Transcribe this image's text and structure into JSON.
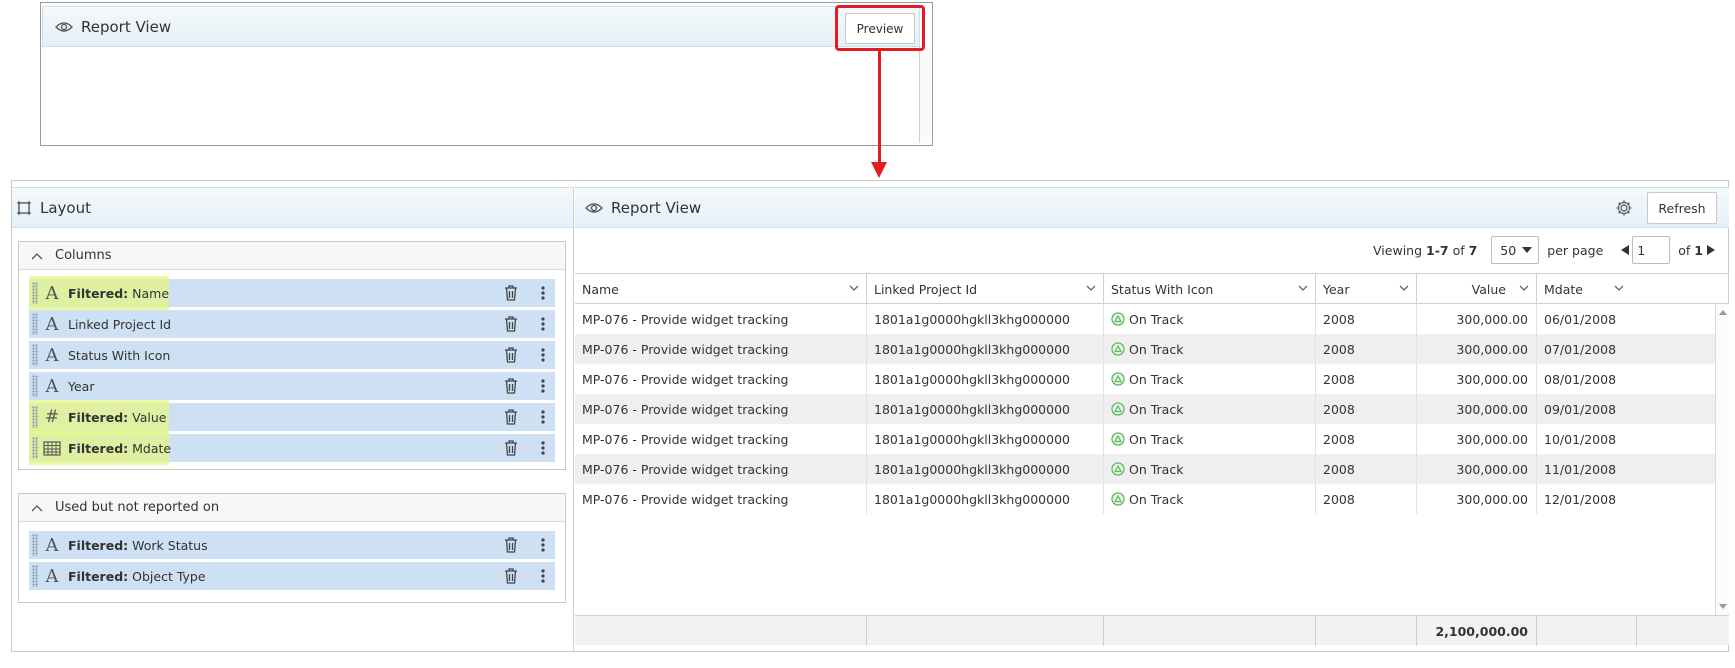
{
  "top_panel": {
    "title": "Report View",
    "preview_label": "Preview"
  },
  "layout": {
    "title": "Layout",
    "columns_section": {
      "label": "Columns",
      "items": [
        {
          "type": "A",
          "prefix": "Filtered:",
          "label": "Name",
          "filtered": true
        },
        {
          "type": "A",
          "prefix": "",
          "label": "Linked Project Id",
          "filtered": false
        },
        {
          "type": "A",
          "prefix": "",
          "label": "Status With Icon",
          "filtered": false
        },
        {
          "type": "A",
          "prefix": "",
          "label": "Year",
          "filtered": false
        },
        {
          "type": "#",
          "prefix": "Filtered:",
          "label": "Value",
          "filtered": true
        },
        {
          "type": "calendar",
          "prefix": "Filtered:",
          "label": "Mdate",
          "filtered": true
        }
      ]
    },
    "unused_section": {
      "label": "Used but not reported on",
      "items": [
        {
          "type": "A",
          "prefix": "Filtered:",
          "label": "Work Status"
        },
        {
          "type": "A",
          "prefix": "Filtered:",
          "label": "Object Type"
        }
      ]
    }
  },
  "report": {
    "title": "Report View",
    "refresh_label": "Refresh",
    "pager": {
      "viewing_prefix": "Viewing ",
      "viewing_range": "1-7",
      "viewing_of": " of ",
      "viewing_total": "7",
      "per_page_value": "50",
      "per_page_label": "per page",
      "page_value": "1",
      "of_label": "of ",
      "total_pages": "1"
    },
    "columns": [
      "Name",
      "Linked Project Id",
      "Status With Icon",
      "Year",
      "Value",
      "Mdate"
    ],
    "rows": [
      [
        "MP-076 - Provide widget tracking",
        "1801a1g0000hgkll3khg000000",
        "On Track",
        "2008",
        "300,000.00",
        "06/01/2008"
      ],
      [
        "MP-076 - Provide widget tracking",
        "1801a1g0000hgkll3khg000000",
        "On Track",
        "2008",
        "300,000.00",
        "07/01/2008"
      ],
      [
        "MP-076 - Provide widget tracking",
        "1801a1g0000hgkll3khg000000",
        "On Track",
        "2008",
        "300,000.00",
        "08/01/2008"
      ],
      [
        "MP-076 - Provide widget tracking",
        "1801a1g0000hgkll3khg000000",
        "On Track",
        "2008",
        "300,000.00",
        "09/01/2008"
      ],
      [
        "MP-076 - Provide widget tracking",
        "1801a1g0000hgkll3khg000000",
        "On Track",
        "2008",
        "300,000.00",
        "10/01/2008"
      ],
      [
        "MP-076 - Provide widget tracking",
        "1801a1g0000hgkll3khg000000",
        "On Track",
        "2008",
        "300,000.00",
        "11/01/2008"
      ],
      [
        "MP-076 - Provide widget tracking",
        "1801a1g0000hgkll3khg000000",
        "On Track",
        "2008",
        "300,000.00",
        "12/01/2008"
      ]
    ],
    "total_value": "2,100,000.00"
  },
  "colors": {
    "highlight_red": "#e31b23",
    "row_blue": "#cde0f4",
    "filtered_yellow": "#e6f587",
    "status_green": "#5cb85c"
  }
}
